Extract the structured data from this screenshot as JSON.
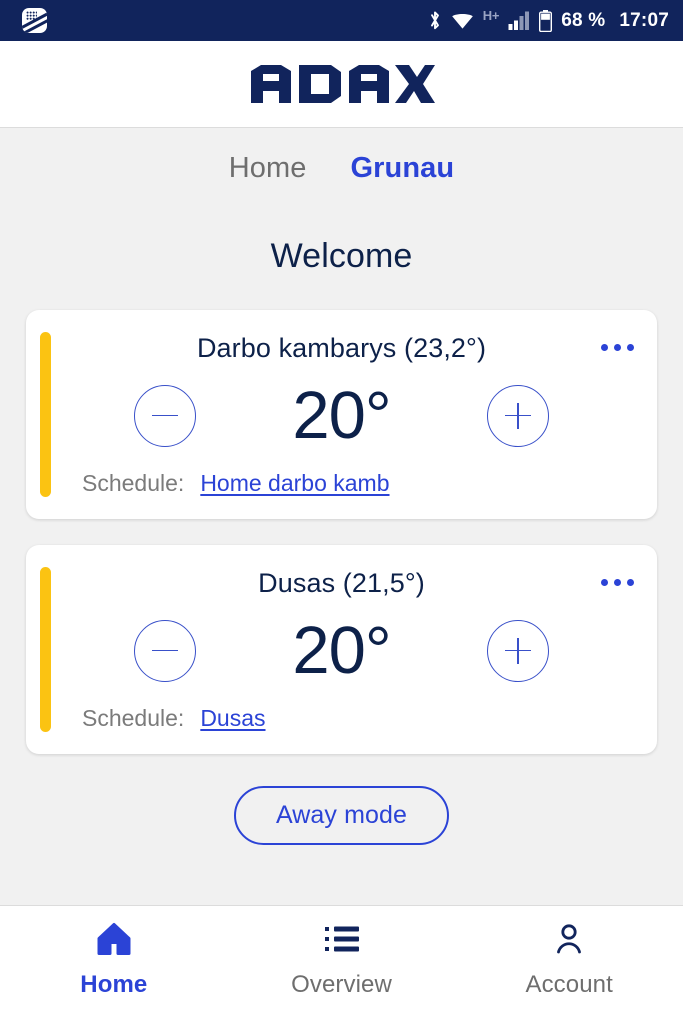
{
  "status_bar": {
    "notification_icon": "app-notification-icon",
    "bluetooth_icon": "bluetooth-icon",
    "wifi_icon": "wifi-icon",
    "network_type": "H+",
    "signal_icon": "cellular-signal-icon",
    "battery_icon": "battery-icon",
    "battery_level": "68 %",
    "battery_percent": 68,
    "clock": "17:07",
    "background_color": "#11245c"
  },
  "header": {
    "brand": "ADAX",
    "brand_color": "#11245c"
  },
  "zone_tabs": {
    "items": [
      {
        "label": "Home",
        "active": false
      },
      {
        "label": "Grunau",
        "active": true
      }
    ],
    "active_color": "#2b43d6",
    "inactive_color": "#6e6e6e"
  },
  "welcome": {
    "title": "Welcome"
  },
  "rooms": [
    {
      "title": "Darbo kambarys (23,2°)",
      "name": "Darbo kambarys",
      "current_temperature": "23,2°",
      "target_temperature": "20°",
      "accent_color": "#fbc312",
      "decrease_label": "−",
      "increase_label": "+",
      "more_label": "•••",
      "schedule_label": "Schedule:",
      "schedule_name": "Home darbo kamb"
    },
    {
      "title": "Dusas (21,5°)",
      "name": "Dusas",
      "current_temperature": "21,5°",
      "target_temperature": "20°",
      "accent_color": "#fbc312",
      "decrease_label": "−",
      "increase_label": "+",
      "more_label": "•••",
      "schedule_label": "Schedule:",
      "schedule_name": "Dusas"
    }
  ],
  "away_mode": {
    "label": "Away mode",
    "color": "#2b43d6"
  },
  "bottom_nav": {
    "items": [
      {
        "label": "Home",
        "icon": "home-icon",
        "active": true
      },
      {
        "label": "Overview",
        "icon": "list-icon",
        "active": false
      },
      {
        "label": "Account",
        "icon": "person-icon",
        "active": false
      }
    ]
  }
}
